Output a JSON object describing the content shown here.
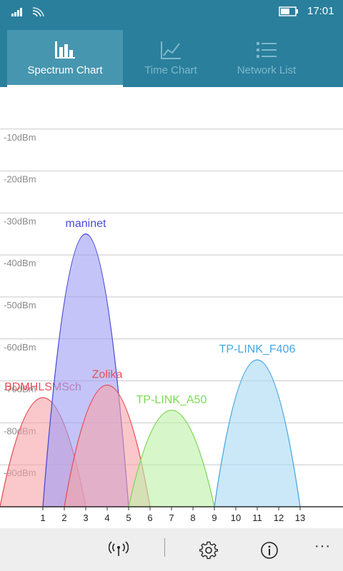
{
  "status": {
    "time": "17:01"
  },
  "tabs": [
    {
      "label": "Spectrum Chart",
      "active": true,
      "icon": "bar-chart-icon"
    },
    {
      "label": "Time Chart",
      "active": false,
      "icon": "line-chart-icon"
    },
    {
      "label": "Network List",
      "active": false,
      "icon": "list-icon"
    }
  ],
  "chart_data": {
    "type": "area",
    "y_labels": [
      "-10dBm",
      "-20dBm",
      "-30dBm",
      "-40dBm",
      "-50dBm",
      "-60dBm",
      "-70dBm",
      "-80dBm",
      "-90dBm"
    ],
    "x_labels": [
      "1",
      "2",
      "3",
      "4",
      "5",
      "6",
      "7",
      "8",
      "9",
      "10",
      "11",
      "12",
      "13"
    ],
    "ylim": [
      -100,
      0
    ],
    "xlim": [
      -1,
      14
    ],
    "series": [
      {
        "name": "BDMHLSMSch",
        "center": 1,
        "peak": -74,
        "color": "#e8505a",
        "fill": "#f7a3a8"
      },
      {
        "name": "maninet",
        "center": 3,
        "peak": -35,
        "color": "#4a4ad8",
        "fill": "#9d9df5"
      },
      {
        "name": "Zolika",
        "center": 4,
        "peak": -71,
        "color": "#e8505a",
        "fill": "#f7a3a8"
      },
      {
        "name": "TP-LINK_A50",
        "center": 7,
        "peak": -77,
        "color": "#7ed957",
        "fill": "#bdf0a6"
      },
      {
        "name": "TP-LINK_F406",
        "center": 11,
        "peak": -65,
        "color": "#4aa8df",
        "fill": "#a8d8f5"
      }
    ]
  },
  "toolbar": {
    "signal": "antenna-icon",
    "settings": "gear-icon",
    "info": "info-icon",
    "more_label": "···"
  }
}
